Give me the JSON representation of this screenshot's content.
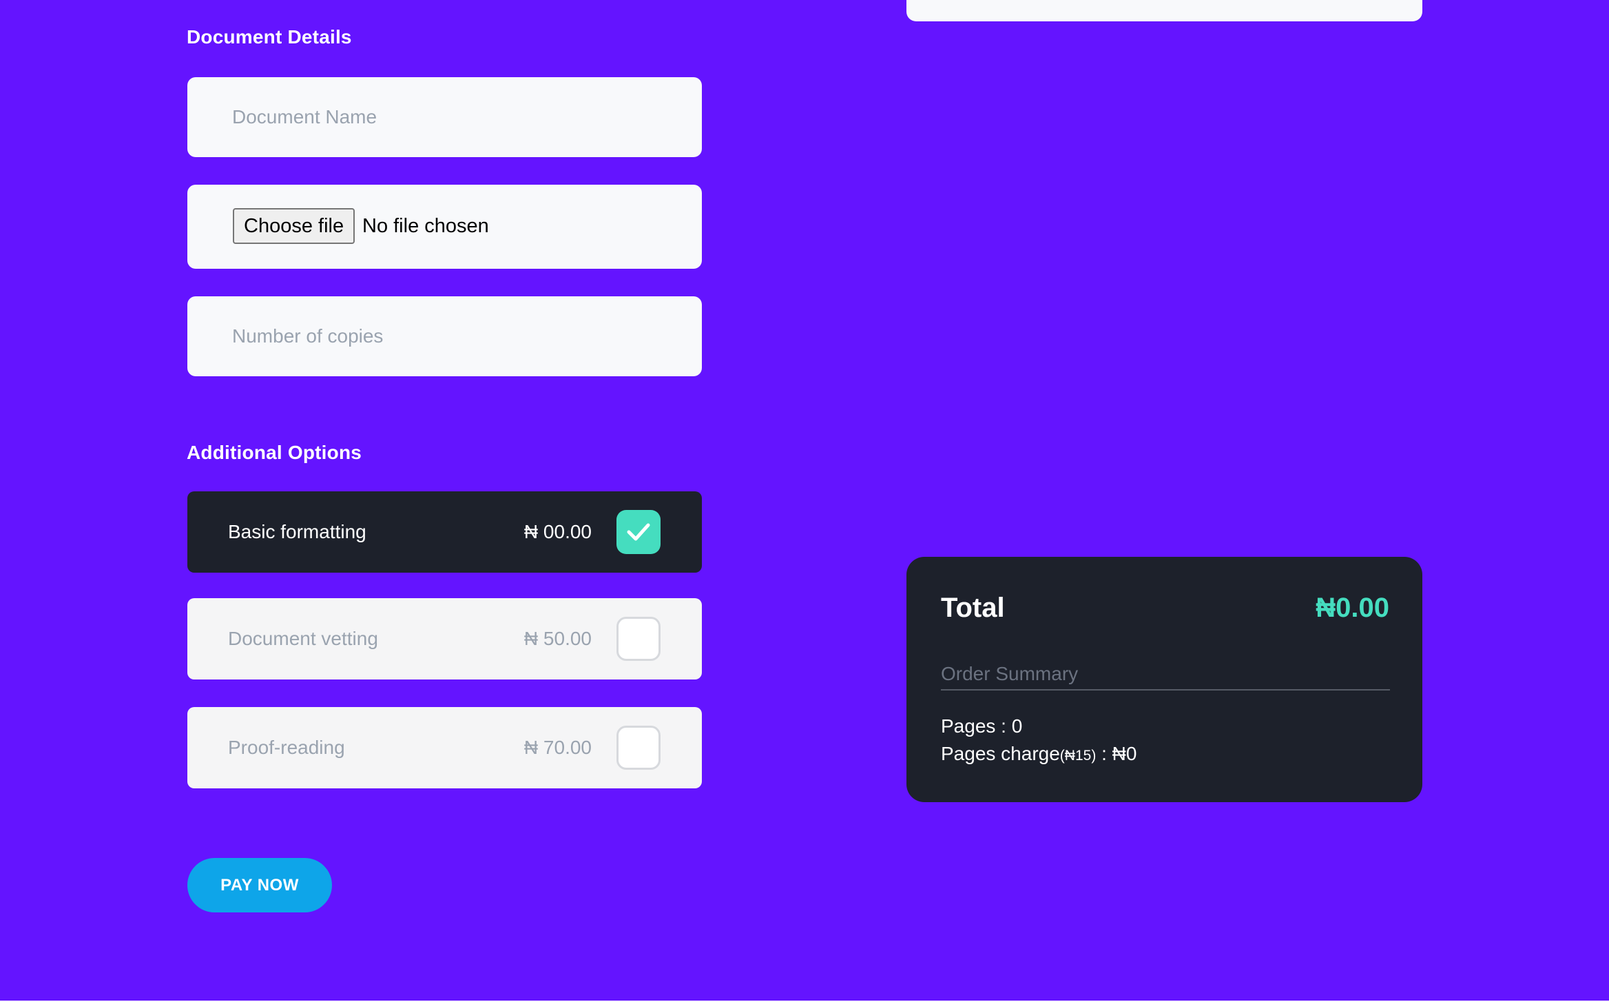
{
  "colors": {
    "background": "#6414ff",
    "field_bg": "#f8f9fb",
    "dark_card": "#1d212b",
    "accent_teal": "#45ddbf",
    "pay_button": "#0ea5e9",
    "placeholder": "#9aa3af"
  },
  "document_details": {
    "title": "Document Details",
    "name_placeholder": "Document Name",
    "file_button_label": "Choose file",
    "file_status": "No file chosen",
    "copies_placeholder": "Number of copies"
  },
  "additional_options": {
    "title": "Additional Options",
    "items": [
      {
        "label": "Basic formatting",
        "price": "₦ 00.00",
        "checked": true
      },
      {
        "label": "Document vetting",
        "price": "₦ 50.00",
        "checked": false
      },
      {
        "label": "Proof-reading",
        "price": "₦ 70.00",
        "checked": false
      }
    ]
  },
  "pay_button_label": "PAY NOW",
  "summary": {
    "total_label": "Total",
    "total_value": "₦0.00",
    "heading": "Order Summary",
    "pages_label": "Pages : ",
    "pages_value": "0",
    "pages_charge_label": "Pages charge",
    "pages_charge_rate": "(₦15)",
    "pages_charge_sep": " : ",
    "pages_charge_value": "₦0"
  },
  "icons": {
    "checkmark": "check-icon"
  }
}
